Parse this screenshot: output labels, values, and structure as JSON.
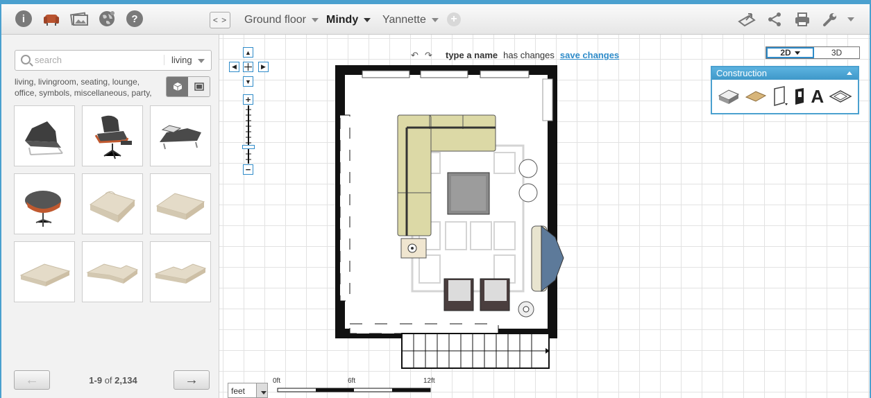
{
  "toolbar_left": {
    "icons": [
      "info-icon",
      "furniture-icon",
      "photos-icon",
      "globe-icon",
      "help-icon"
    ],
    "info_glyph": "i",
    "help_glyph": "?"
  },
  "floor_tabs": {
    "tabs": [
      {
        "label": "Ground floor",
        "active": false
      },
      {
        "label": "Mindy",
        "active": true
      },
      {
        "label": "Yannette",
        "active": false
      }
    ],
    "add_glyph": "+"
  },
  "collapse_glyph": "< >",
  "search": {
    "placeholder": "search",
    "category": "living"
  },
  "tags": "living, livingroom, seating, lounge, office, symbols, miscellaneous, party,",
  "pager": {
    "range": "1-9",
    "of": "of",
    "total": "2,134",
    "prev_glyph": "←",
    "next_glyph": "→"
  },
  "status": {
    "name": "type a name",
    "changes": "has changes",
    "save": "save changes",
    "undo_glyph": "↶",
    "redo_glyph": "↷"
  },
  "view_mode": {
    "two_d": "2D",
    "three_d": "3D",
    "active": "2D"
  },
  "construction": {
    "title": "Construction",
    "tools": [
      "room-icon",
      "floor-icon",
      "door-icon",
      "window-icon",
      "text-icon",
      "area-icon"
    ],
    "text_glyph": "A"
  },
  "nav_controls": {
    "up": "▲",
    "down": "▼",
    "left": "◀",
    "right": "▶",
    "zoom_in": "+",
    "zoom_out": "−"
  },
  "units": {
    "selected": "feet",
    "scale_labels": [
      "0ft",
      "6ft",
      "12ft"
    ]
  },
  "colors": {
    "accent": "#2e8bc9",
    "sofa": "#dcd9a6",
    "frame": "#4aa0cf"
  }
}
